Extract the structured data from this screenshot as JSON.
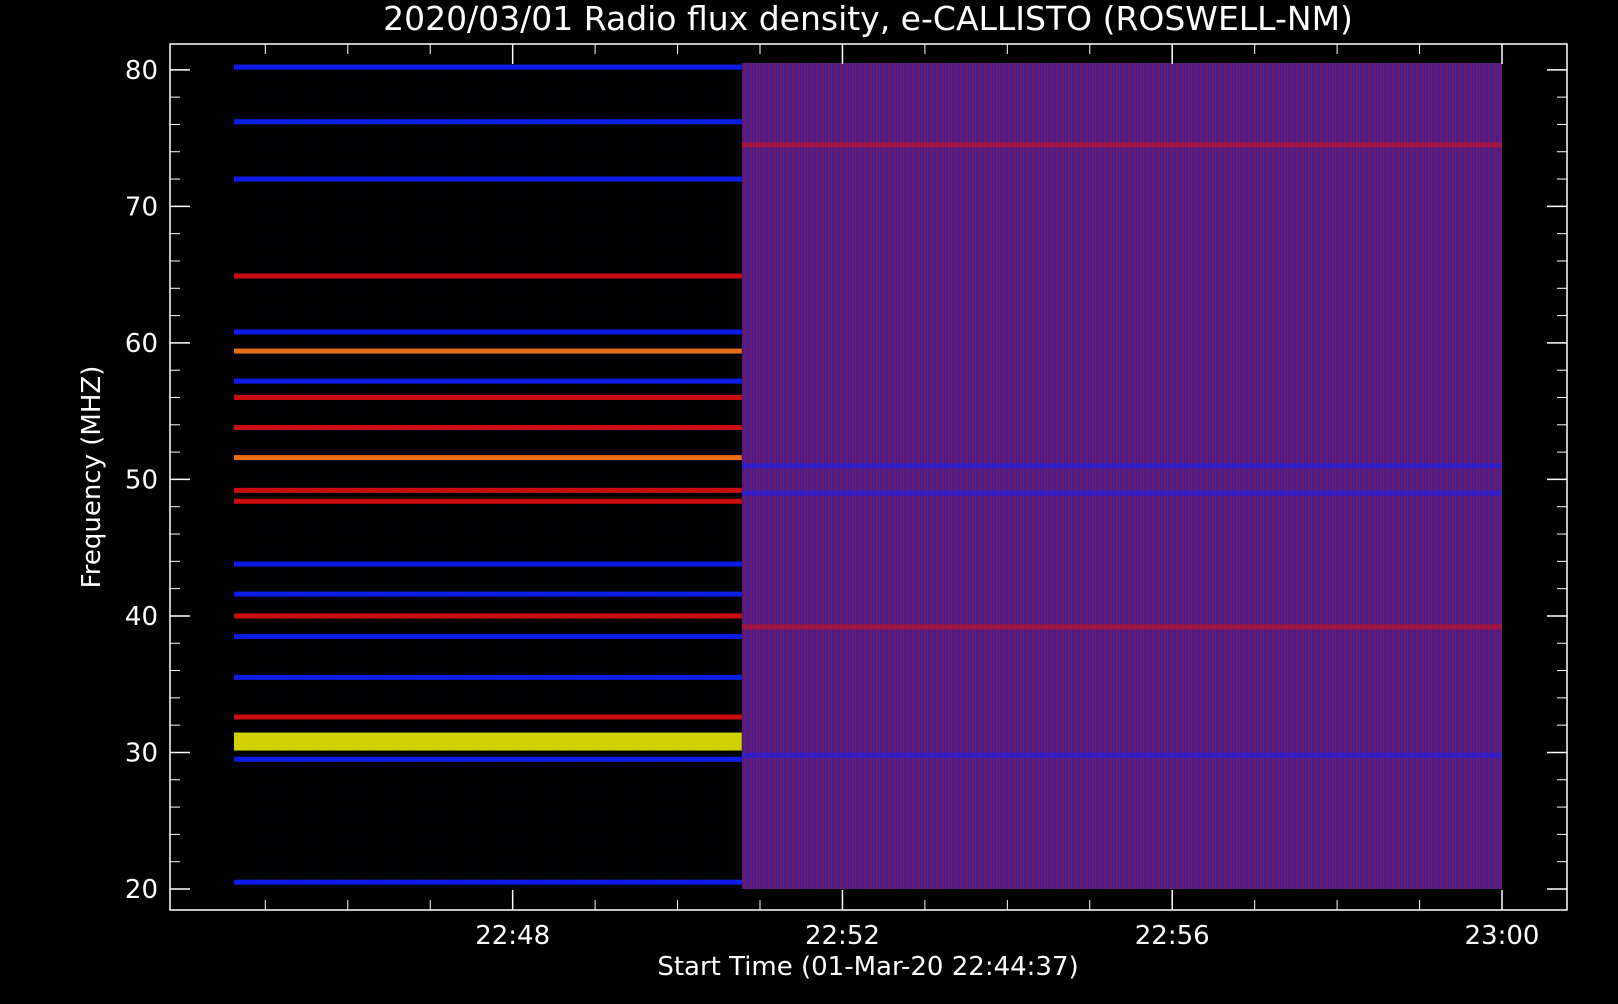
{
  "chart_data": {
    "type": "heatmap",
    "title": "2020/03/01  Radio flux density, e-CALLISTO (ROSWELL-NM)",
    "xlabel": "Start Time (01-Mar-20 22:44:37)",
    "ylabel": "Frequency (MHZ)",
    "x_ticks": [
      "22:48",
      "22:52",
      "22:56",
      "23:00"
    ],
    "y_ticks": [
      "20",
      "30",
      "40",
      "50",
      "60",
      "70",
      "80"
    ],
    "y_tick_values": [
      20,
      30,
      40,
      50,
      60,
      70,
      80
    ],
    "x_tick_minutes": [
      48,
      52,
      56,
      60
    ],
    "xlim_minutes": [
      44.62,
      60.0
    ],
    "ylim": [
      80.5,
      20.0
    ],
    "y_reversed": true,
    "colormap": [
      "#000000",
      "#0000ff",
      "#ff0000",
      "#ffff00"
    ],
    "segments": [
      {
        "start_minute": 44.62,
        "end_minute": 50.78,
        "background": "#000000",
        "bright_bands_mhz": [
          {
            "mhz": 20.5,
            "level": "blue"
          },
          {
            "mhz": 29.5,
            "level": "blue"
          },
          {
            "mhz": 30.8,
            "level": "yellow"
          },
          {
            "mhz": 32.6,
            "level": "red"
          },
          {
            "mhz": 35.5,
            "level": "blue"
          },
          {
            "mhz": 38.5,
            "level": "blue"
          },
          {
            "mhz": 40.0,
            "level": "red"
          },
          {
            "mhz": 41.6,
            "level": "blue"
          },
          {
            "mhz": 43.8,
            "level": "blue"
          },
          {
            "mhz": 48.4,
            "level": "red"
          },
          {
            "mhz": 49.2,
            "level": "red"
          },
          {
            "mhz": 51.6,
            "level": "orange"
          },
          {
            "mhz": 53.8,
            "level": "red"
          },
          {
            "mhz": 56.0,
            "level": "red"
          },
          {
            "mhz": 57.2,
            "level": "blue"
          },
          {
            "mhz": 59.4,
            "level": "orange"
          },
          {
            "mhz": 60.8,
            "level": "blue"
          },
          {
            "mhz": 64.9,
            "level": "red"
          },
          {
            "mhz": 72.0,
            "level": "blue"
          },
          {
            "mhz": 76.2,
            "level": "blue"
          },
          {
            "mhz": 80.2,
            "level": "blue"
          }
        ]
      },
      {
        "start_minute": 50.78,
        "end_minute": 60.0,
        "background": "#5a1a8a",
        "bright_bands_mhz": [
          {
            "mhz": 29.8,
            "level": "blue"
          },
          {
            "mhz": 39.2,
            "level": "red"
          },
          {
            "mhz": 49.0,
            "level": "blue"
          },
          {
            "mhz": 51.0,
            "level": "blue"
          },
          {
            "mhz": 74.5,
            "level": "red"
          }
        ]
      }
    ]
  }
}
